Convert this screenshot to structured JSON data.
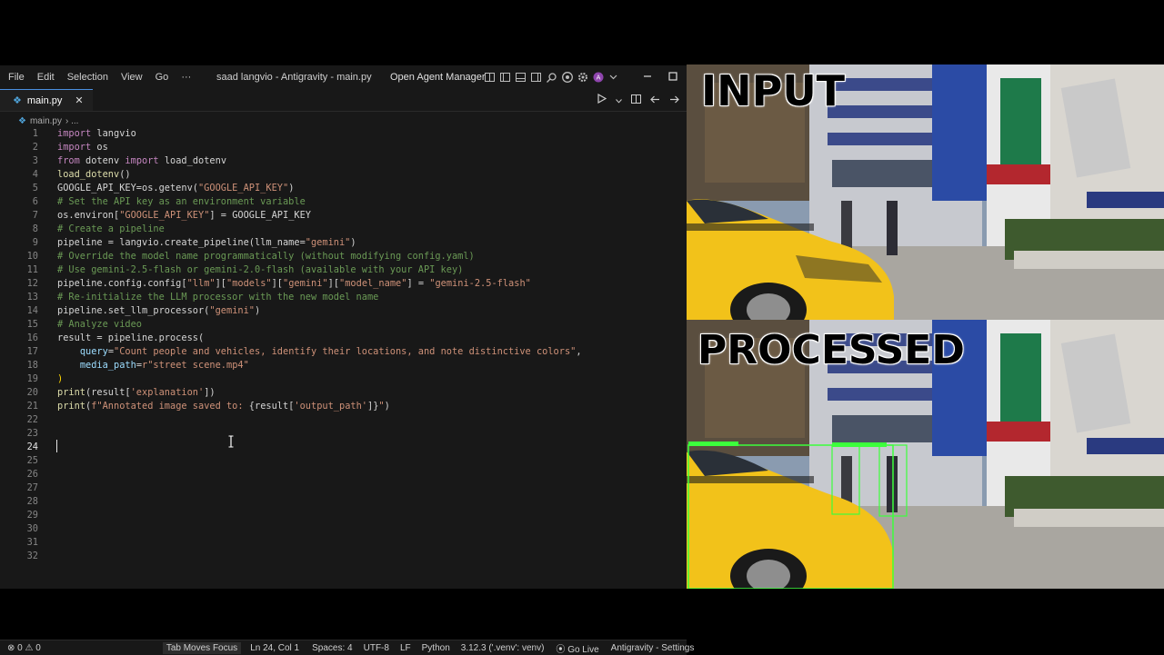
{
  "menu": [
    "File",
    "Edit",
    "Selection",
    "View",
    "Go",
    "···"
  ],
  "window_title": "saad langvio - Antigravity - main.py",
  "agent_manager": "Open Agent Manager",
  "tab": {
    "name": "main.py",
    "close": "✕"
  },
  "breadcrumb": "main.py",
  "breadcrumb_more": "› ...",
  "code_lines": [
    {
      "n": "1",
      "segs": [
        {
          "t": "import",
          "c": "kw"
        },
        {
          "t": " langvio",
          "c": ""
        }
      ]
    },
    {
      "n": "2",
      "segs": [
        {
          "t": "import",
          "c": "kw"
        },
        {
          "t": " os",
          "c": ""
        }
      ]
    },
    {
      "n": "3",
      "segs": [
        {
          "t": "from",
          "c": "kw"
        },
        {
          "t": " dotenv ",
          "c": ""
        },
        {
          "t": "import",
          "c": "kw"
        },
        {
          "t": " load_dotenv",
          "c": ""
        }
      ]
    },
    {
      "n": "4",
      "segs": [
        {
          "t": "load_dotenv",
          "c": "fn"
        },
        {
          "t": "()",
          "c": ""
        }
      ]
    },
    {
      "n": "5",
      "segs": [
        {
          "t": "GOOGLE_API_KEY=os.getenv(",
          "c": ""
        },
        {
          "t": "\"GOOGLE_API_KEY\"",
          "c": "st"
        },
        {
          "t": ")",
          "c": ""
        }
      ]
    },
    {
      "n": "6",
      "segs": [
        {
          "t": "# Set the API key as an environment variable",
          "c": "cm"
        }
      ]
    },
    {
      "n": "7",
      "segs": [
        {
          "t": "os.environ[",
          "c": ""
        },
        {
          "t": "\"GOOGLE_API_KEY\"",
          "c": "st"
        },
        {
          "t": "] = GOOGLE_API_KEY",
          "c": ""
        }
      ]
    },
    {
      "n": "8",
      "segs": [
        {
          "t": "# Create a pipeline",
          "c": "cm"
        }
      ]
    },
    {
      "n": "9",
      "segs": [
        {
          "t": "pipeline = langvio.create_pipeline(llm_name=",
          "c": ""
        },
        {
          "t": "\"gemini\"",
          "c": "st"
        },
        {
          "t": ")",
          "c": ""
        }
      ]
    },
    {
      "n": "10",
      "segs": [
        {
          "t": "# Override the model name programmatically (without modifying config.yaml)",
          "c": "cm"
        }
      ]
    },
    {
      "n": "11",
      "segs": [
        {
          "t": "# Use gemini-2.5-flash or gemini-2.0-flash (available with your API key)",
          "c": "cm"
        }
      ]
    },
    {
      "n": "12",
      "segs": [
        {
          "t": "pipeline.config.config[",
          "c": ""
        },
        {
          "t": "\"llm\"",
          "c": "st"
        },
        {
          "t": "][",
          "c": ""
        },
        {
          "t": "\"models\"",
          "c": "st"
        },
        {
          "t": "][",
          "c": ""
        },
        {
          "t": "\"gemini\"",
          "c": "st"
        },
        {
          "t": "][",
          "c": ""
        },
        {
          "t": "\"model_name\"",
          "c": "st"
        },
        {
          "t": "] = ",
          "c": ""
        },
        {
          "t": "\"gemini-2.5-flash\"",
          "c": "st"
        }
      ]
    },
    {
      "n": "13",
      "segs": [
        {
          "t": "# Re-initialize the LLM processor with the new model name",
          "c": "cm"
        }
      ]
    },
    {
      "n": "14",
      "segs": [
        {
          "t": "pipeline.set_llm_processor(",
          "c": ""
        },
        {
          "t": "\"gemini\"",
          "c": "st"
        },
        {
          "t": ")",
          "c": ""
        }
      ]
    },
    {
      "n": "15",
      "segs": [
        {
          "t": "# Analyze video",
          "c": "cm"
        }
      ]
    },
    {
      "n": "16",
      "segs": [
        {
          "t": "result = pipeline.process(",
          "c": ""
        }
      ]
    },
    {
      "n": "17",
      "segs": [
        {
          "t": "    ",
          "c": ""
        },
        {
          "t": "query",
          "c": "pm"
        },
        {
          "t": "=",
          "c": ""
        },
        {
          "t": "\"Count people and vehicles, identify their locations, and note distinctive colors\"",
          "c": "st"
        },
        {
          "t": ",",
          "c": ""
        }
      ]
    },
    {
      "n": "18",
      "segs": [
        {
          "t": "    ",
          "c": ""
        },
        {
          "t": "media_path",
          "c": "pm"
        },
        {
          "t": "=",
          "c": ""
        },
        {
          "t": "r\"street scene.mp4\"",
          "c": "st"
        }
      ]
    },
    {
      "n": "19",
      "segs": [
        {
          "t": ")",
          "c": "br"
        }
      ]
    },
    {
      "n": "20",
      "segs": [
        {
          "t": "print",
          "c": "fn"
        },
        {
          "t": "(result[",
          "c": ""
        },
        {
          "t": "'explanation'",
          "c": "st"
        },
        {
          "t": "])",
          "c": ""
        }
      ]
    },
    {
      "n": "21",
      "segs": [
        {
          "t": "print",
          "c": "fn"
        },
        {
          "t": "(",
          "c": ""
        },
        {
          "t": "f\"Annotated image saved to: ",
          "c": "st"
        },
        {
          "t": "{result[",
          "c": ""
        },
        {
          "t": "'output_path'",
          "c": "st"
        },
        {
          "t": "]}",
          "c": ""
        },
        {
          "t": "\"",
          "c": "st"
        },
        {
          "t": ")",
          "c": ""
        }
      ]
    },
    {
      "n": "22",
      "segs": []
    },
    {
      "n": "23",
      "segs": []
    },
    {
      "n": "24",
      "segs": [],
      "current": true
    },
    {
      "n": "25",
      "segs": []
    },
    {
      "n": "26",
      "segs": []
    },
    {
      "n": "27",
      "segs": []
    },
    {
      "n": "28",
      "segs": []
    },
    {
      "n": "29",
      "segs": []
    },
    {
      "n": "30",
      "segs": []
    },
    {
      "n": "31",
      "segs": []
    },
    {
      "n": "32",
      "segs": []
    }
  ],
  "status": {
    "problems": "⊗ 0 ⚠ 0",
    "tab_focus": "Tab Moves Focus",
    "position": "Ln 24, Col 1",
    "spaces": "Spaces: 4",
    "encoding": "UTF-8",
    "eol": "LF",
    "language": "Python",
    "interpreter": "3.12.3 ('.venv': venv)",
    "go_live": "Go Live",
    "settings": "Antigravity - Settings"
  },
  "video": {
    "input_label": "INPUT",
    "processed_label": "PROCESSED"
  },
  "colors": {
    "editor_bg": "#181818",
    "accent": "#4a8fe0",
    "taxi": "#f2c21a"
  }
}
